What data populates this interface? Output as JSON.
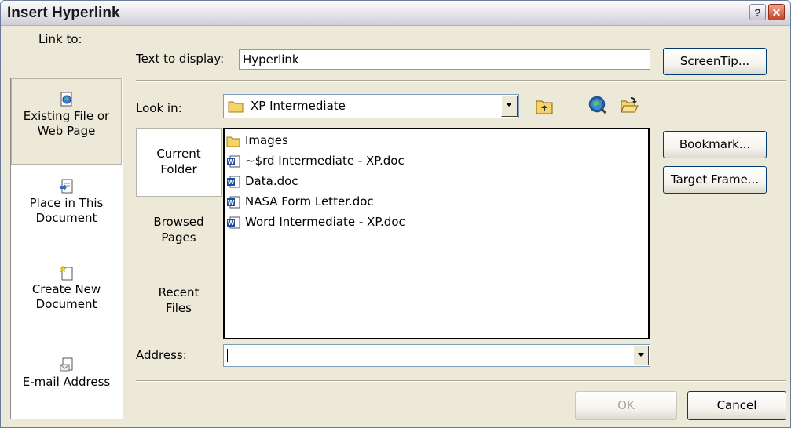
{
  "dialog": {
    "title": "Insert Hyperlink"
  },
  "titlebar_buttons": {
    "help": "?",
    "close": "✕"
  },
  "link_to": {
    "label": "Link to:",
    "places": [
      {
        "line1": "Existing File or",
        "line2": "Web Page",
        "icon": "existing-file-icon"
      },
      {
        "line1": "Place in This",
        "line2": "Document",
        "icon": "place-in-document-icon"
      },
      {
        "line1": "Create New",
        "line2": "Document",
        "icon": "new-document-icon"
      },
      {
        "line1": "E-mail Address",
        "line2": "",
        "icon": "email-address-icon"
      }
    ]
  },
  "text_to_display": {
    "label": "Text to display:",
    "value": "Hyperlink"
  },
  "look_in": {
    "label": "Look in:",
    "value": "XP Intermediate"
  },
  "browse_nav": [
    {
      "line1": "Current",
      "line2": "Folder"
    },
    {
      "line1": "Browsed",
      "line2": "Pages"
    },
    {
      "line1": "Recent",
      "line2": "Files"
    }
  ],
  "files": [
    {
      "name": "Images",
      "type": "folder"
    },
    {
      "name": "~$rd Intermediate - XP.doc",
      "type": "word"
    },
    {
      "name": "Data.doc",
      "type": "word"
    },
    {
      "name": "NASA Form Letter.doc",
      "type": "word"
    },
    {
      "name": "Word Intermediate - XP.doc",
      "type": "word"
    }
  ],
  "address": {
    "label": "Address:",
    "value": ""
  },
  "buttons": {
    "screentip": "ScreenTip...",
    "bookmark": "Bookmark...",
    "target_frame": "Target Frame...",
    "ok": "OK",
    "cancel": "Cancel"
  },
  "colors": {
    "folder": "#f5d36b",
    "word_blue": "#1d4fa3",
    "border_dark": "#003c74"
  }
}
